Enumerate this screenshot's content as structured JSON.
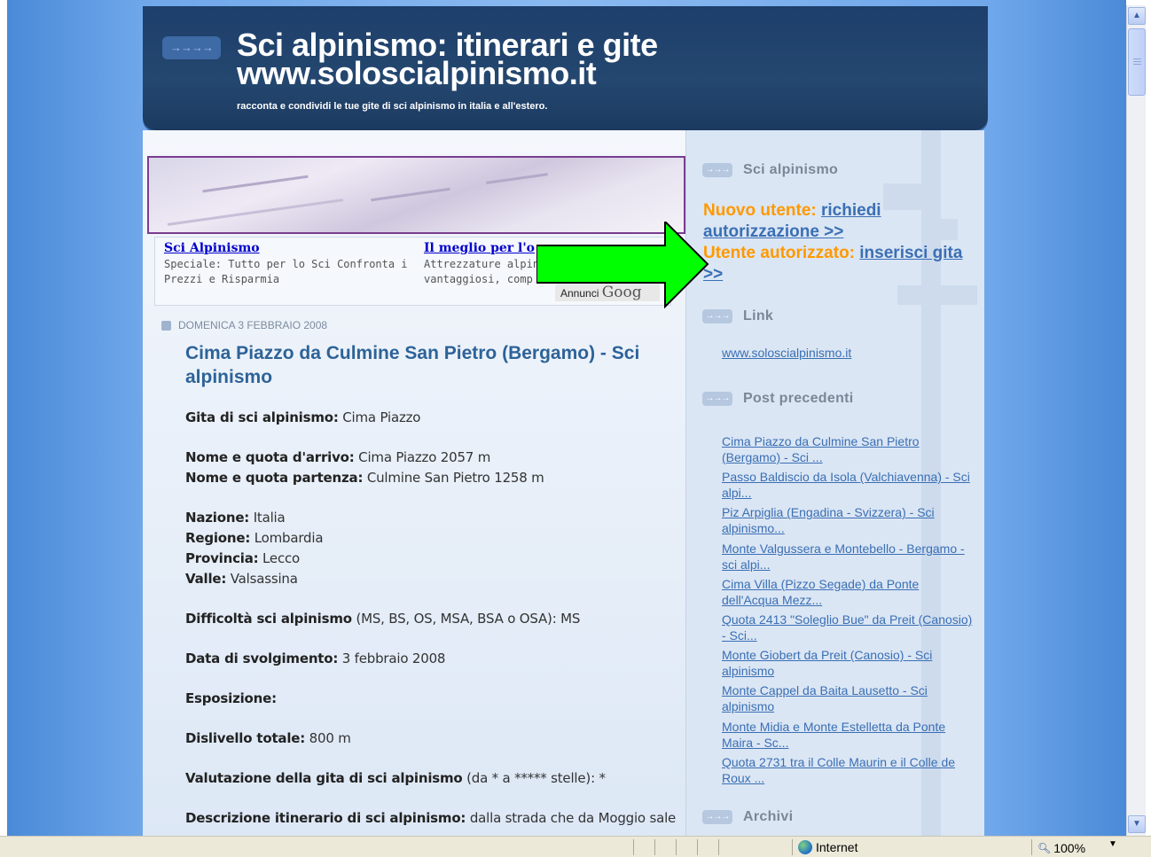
{
  "header": {
    "title_line1": "Sci alpinismo: itinerari e gite",
    "title_line2": "www.soloscialpinismo.it",
    "description": "racconta e condividi le tue gite di sci alpinismo in italia e all'estero."
  },
  "ads": {
    "ad1": {
      "title": "Sci Alpinismo",
      "text_line1": "Speciale: Tutto per lo Sci Confronta i",
      "text_line2": "Prezzi e Risparmia"
    },
    "ad2": {
      "title": "Il meglio per l'o",
      "text_line1": "Attrezzature alpini",
      "text_line2": "vantaggiosi, comp"
    },
    "label_annunci": "Annunci",
    "label_google": "Goog"
  },
  "post": {
    "date": "DOMENICA 3 FEBBRAIO 2008",
    "title": "Cima Piazzo da Culmine San Pietro (Bergamo) - Sci alpinismo",
    "fields": {
      "gita_label": "Gita di sci alpinismo:",
      "gita_value": "Cima Piazzo",
      "arrivo_label": "Nome e quota d'arrivo:",
      "arrivo_value": "Cima Piazzo 2057 m",
      "partenza_label": "Nome e quota partenza:",
      "partenza_value": "Culmine San Pietro 1258 m",
      "nazione_label": "Nazione:",
      "nazione_value": "Italia",
      "regione_label": "Regione:",
      "regione_value": "Lombardia",
      "provincia_label": "Provincia:",
      "provincia_value": "Lecco",
      "valle_label": "Valle:",
      "valle_value": "Valsassina",
      "difficolta_label": "Difficoltà sci alpinismo",
      "difficolta_value": "(MS, BS, OS, MSA, BSA o OSA): MS",
      "data_label": "Data di svolgimento:",
      "data_value": "3 febbraio 2008",
      "esposizione_label": "Esposizione:",
      "dislivello_label": "Dislivello totale:",
      "dislivello_value": "800 m",
      "valutazione_label": "Valutazione della gita di sci alpinismo",
      "valutazione_value": "(da * a ***** stelle): *",
      "descrizione_label": "Descrizione itinerario di sci alpinismo:",
      "descrizione_value": "dalla strada che da Moggio sale"
    }
  },
  "sidebar": {
    "section1_title": "Sci alpinismo",
    "nuovo_utente_label": "Nuovo utente:",
    "nuovo_utente_link": "richiedi autorizzazione >>",
    "utente_autorizzato_label": "Utente autorizzato:",
    "utente_autorizzato_link": "inserisci gita >>",
    "section2_title": "Link",
    "link1": "www.soloscialpinismo.it",
    "section3_title": "Post precedenti",
    "previous_posts": [
      "Cima Piazzo da Culmine San Pietro (Bergamo) - Sci ...",
      "Passo Baldiscio da Isola (Valchiavenna) - Sci alpi...",
      "Piz Arpiglia (Engadina - Svizzera) - Sci alpinismo...",
      "Monte Valgussera e Montebello - Bergamo - sci alpi...",
      "Cima Villa (Pizzo Segade) da Ponte dell'Acqua Mezz...",
      "Quota 2413 \"Soleglio Bue\" da Preit (Canosio) - Sci...",
      "Monte Giobert da Preit (Canosio) - Sci alpinismo",
      "Monte Cappel da Baita Lausetto - Sci alpinismo",
      "Monte Midia e Monte Estelletta da Ponte Maira - Sc...",
      "Quota 2731 tra il Colle Maurin e il Colle de Roux ..."
    ],
    "section4_title": "Archivi"
  },
  "statusbar": {
    "zone": "Internet",
    "zoom": "100%"
  },
  "colors": {
    "header_bg": "#1d3f6b",
    "post_title": "#2d6398",
    "orange_label": "#ff9900",
    "link": "#3a6fb4",
    "annotation_arrow": "#00ff00"
  }
}
